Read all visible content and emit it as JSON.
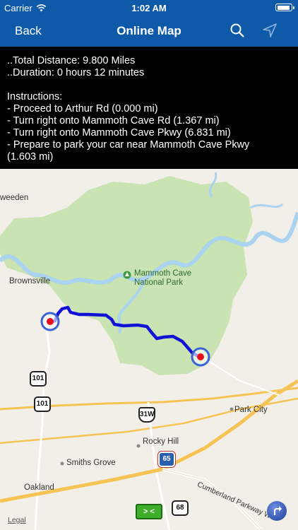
{
  "status_bar": {
    "carrier": "Carrier",
    "time": "1:02 AM"
  },
  "nav": {
    "back_label": "Back",
    "title": "Online Map"
  },
  "instructions": {
    "summary": [
      "..Total Distance: 9.800 Miles",
      "..Duration: 0 hours 12 minutes"
    ],
    "header": "Instructions:",
    "steps": [
      "- Proceed to Arthur Rd (0.000 mi)",
      "- Turn right onto Mammoth Cave Rd (1.367 mi)",
      "- Turn right onto Mammoth Cave Pkwy (6.831 mi)",
      "- Prepare to park your car near Mammoth Cave Pkwy",
      "(1.603 mi)"
    ]
  },
  "map": {
    "places": {
      "weeden": "weeden",
      "brownsville": "Brownsville",
      "park_line1": "Mammoth Cave",
      "park_line2": "National Park",
      "park_city": "Park City",
      "rocky_hill": "Rocky Hill",
      "smiths_grove": "Smiths Grove",
      "oakland": "Oakland",
      "parkway": "Cumberland Parkway W"
    },
    "shields": {
      "r101a": "101",
      "r101b": "101",
      "r31w": "31W",
      "i65": "65",
      "r68": "68"
    },
    "legal": "Legal",
    "nav_button_label": "> <",
    "colors": {
      "route": "#1212d6",
      "park": "#c9e3b3",
      "water": "#a9d3ee",
      "marker": "#e8111b",
      "highway": "#f6c355",
      "bar": "#0f5aa8"
    }
  }
}
